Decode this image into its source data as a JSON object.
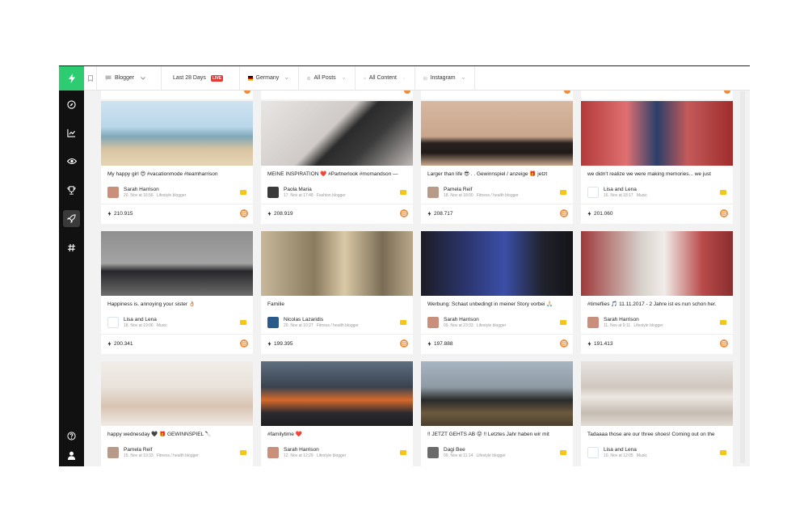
{
  "filters": {
    "category": "Blogger",
    "period": "Last 28 Days",
    "live_badge": "LIVE",
    "country": "Germany",
    "posts": "All Posts",
    "content": "All Content",
    "network": "Instagram"
  },
  "sidebar": {
    "items": [
      {
        "icon": "compass-icon"
      },
      {
        "icon": "chart-icon"
      },
      {
        "icon": "eye-icon"
      },
      {
        "icon": "trophy-icon"
      },
      {
        "icon": "rocket-icon"
      },
      {
        "icon": "hashtag-icon"
      }
    ],
    "bottom": [
      {
        "icon": "help-icon"
      },
      {
        "icon": "user-icon"
      }
    ]
  },
  "colors": {
    "accent_green": "#2ecc71",
    "instagram_orange": "#f08b3a",
    "sidebar_bg": "#111111"
  },
  "cards": [
    {
      "caption": "My happy girl 😍 #vacationmode #teamharrison",
      "author": "Sarah Harrison",
      "date": "20. Nov at 16:56",
      "category": "Lifestyle blogger",
      "reach": "210.915"
    },
    {
      "caption": "MEINE INSPIRATION ❤️ #Partnerlook #momandson —",
      "author": "Paola Maria",
      "date": "17. Nov at 17:48",
      "category": "Fashion blogger",
      "reach": "208.919"
    },
    {
      "caption": "Larger than life 😎 . . Gewinnspiel / anzeige 🎁 jetzt",
      "author": "Pamela Reif",
      "date": "18. Nov at 18:00",
      "category": "Fitness / health blogger",
      "reach": "208.717"
    },
    {
      "caption": "we didn't realize we were making memories... we just",
      "author": "Lisa and Lena",
      "date": "16. Nov at 18:17",
      "category": "Music",
      "reach": "201.060"
    },
    {
      "caption": "Happiness is. annoying your sister 👌🏼",
      "author": "Lisa and Lena",
      "date": "18. Nov at 19:06",
      "category": "Music",
      "reach": "200.341"
    },
    {
      "caption": "Familie",
      "author": "Nicolas Lazaridis",
      "date": "20. Nov at 10:27",
      "category": "Fitness / health blogger",
      "reach": "199.395"
    },
    {
      "caption": "Werbung: Schaut unbedingt in meiner Story vorbei 🙏🏻",
      "author": "Sarah Harrison",
      "date": "09. Nov at 23:33",
      "category": "Lifestyle blogger",
      "reach": "197.888"
    },
    {
      "caption": "#timeflies 🎵 11.11.2017 - 2 Jahre ist es nun schon her.",
      "author": "Sarah Harrison",
      "date": "11. Nov at 9:11",
      "category": "Lifestyle blogger",
      "reach": "191.413"
    },
    {
      "caption": "happy wednesday 🖤 🎁 GEWINNSPIEL 🔪",
      "author": "Pamela Reif",
      "date": "15. Nov at 19:33",
      "category": "Fitness / health blogger",
      "reach": ""
    },
    {
      "caption": "#familytime ❤️",
      "author": "Sarah Harrison",
      "date": "12. Nov at 12:29",
      "category": "Lifestyle blogger",
      "reach": ""
    },
    {
      "caption": "!! JETZT GEHTS AB 😝 !! Letztes Jahr haben wir mit",
      "author": "Dagi Bee",
      "date": "09. Nov at 11:14",
      "category": "Lifestyle blogger",
      "reach": ""
    },
    {
      "caption": "Tadaaaa those are our three shoes! Coming out on the",
      "author": "Lisa and Lena",
      "date": "10. Nov at 12:05",
      "category": "Music",
      "reach": ""
    }
  ]
}
